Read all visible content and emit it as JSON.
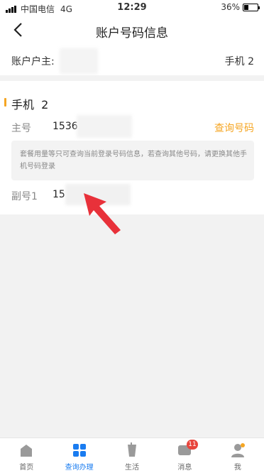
{
  "status_bar": {
    "carrier": "中国电信",
    "network": "4G",
    "time": "12:29",
    "battery": "36%",
    "battery_level": 0.36
  },
  "nav": {
    "title": "账户号码信息"
  },
  "owner": {
    "label": "账户户主:",
    "phone": "手机 2"
  },
  "card": {
    "title": "手机  2",
    "main_label": "主号",
    "main_number": "1536",
    "query_link": "查询号码",
    "notice": "套餐用量等只可查询当前登录号码信息，若查询其他号码，请更换其他手机号码登录",
    "sub_label": "副号1",
    "sub_number": "15"
  },
  "tabs": [
    {
      "label": "首页",
      "icon": "home-icon",
      "active": false
    },
    {
      "label": "查询办理",
      "icon": "grid-icon",
      "active": true
    },
    {
      "label": "生活",
      "icon": "cup-icon",
      "active": false
    },
    {
      "label": "消息",
      "icon": "message-icon",
      "active": false,
      "badge": "11"
    },
    {
      "label": "我",
      "icon": "user-icon",
      "active": false
    }
  ],
  "colors": {
    "accent": "#f5a623",
    "active_tab": "#1a7cf0",
    "badge": "#e8453c",
    "arrow": "#e8313a"
  }
}
